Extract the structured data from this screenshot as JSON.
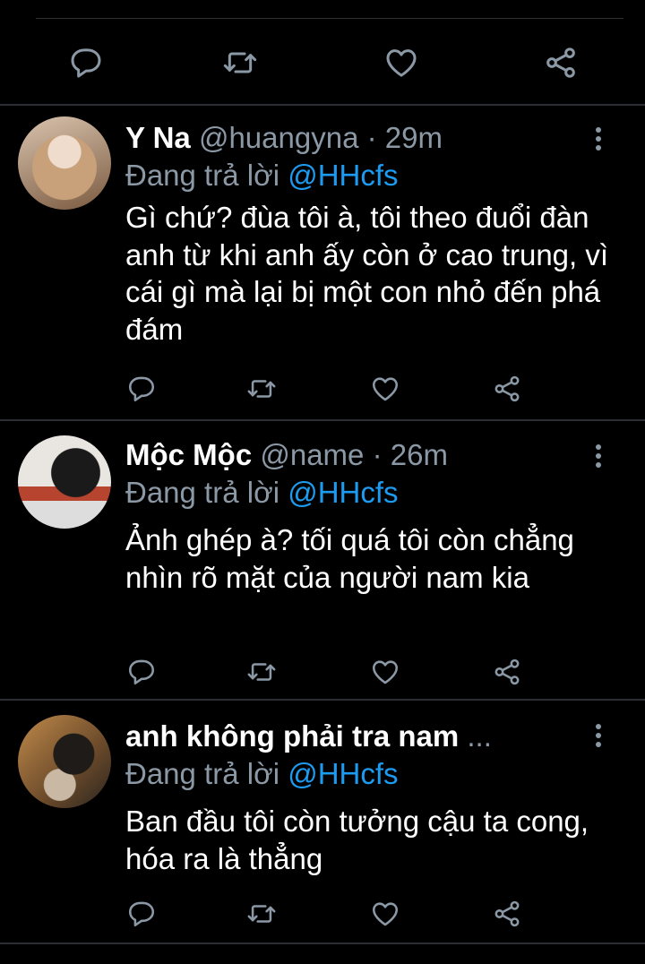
{
  "icons": {
    "reply": "reply-icon",
    "retweet": "retweet-icon",
    "like": "heart-icon",
    "share": "share-icon",
    "more": "more-vertical-icon"
  },
  "colors": {
    "background": "#000000",
    "text": "#ffffff",
    "muted": "#8b98a5",
    "accent": "#1d9bf0",
    "icon": "#8b98a5",
    "divider": "#2b2f33"
  },
  "tweets": [
    {
      "name": "Y Na",
      "handle": "@huangyna",
      "time": "· 29m",
      "reply_prefix": "Đang trả lời",
      "reply_handle": "@HHcfs",
      "text": "Gì chứ? đùa tôi à, tôi theo đuổi đàn anh từ khi anh ấy còn ở cao trung, vì cái gì mà lại bị một con nhỏ đến phá đám"
    },
    {
      "name": "Mộc Mộc",
      "handle": "@name",
      "time": "· 26m",
      "reply_prefix": "Đang trả lời",
      "reply_handle": "@HHcfs",
      "text": "Ảnh ghép à? tối quá tôi còn chẳng nhìn rõ mặt của người nam kia"
    },
    {
      "name": "anh không phải tra nam",
      "handle": "...",
      "time": "",
      "reply_prefix": "Đang trả lời",
      "reply_handle": "@HHcfs",
      "text": "Ban đầu tôi còn tưởng cậu ta cong, hóa ra là thẳng"
    }
  ]
}
